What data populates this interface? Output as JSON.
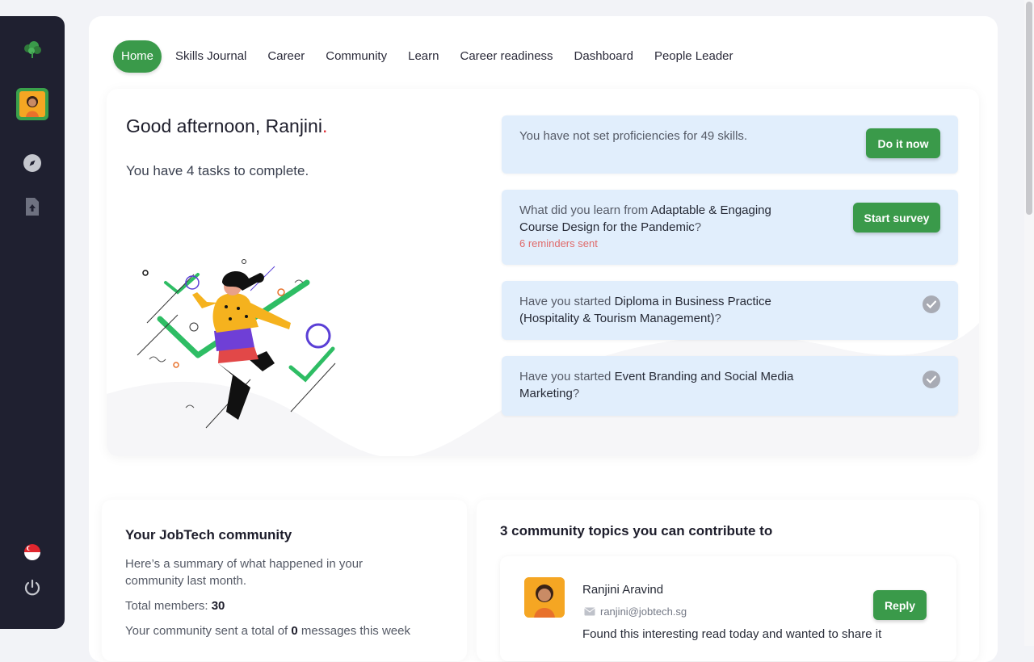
{
  "nav": {
    "items": [
      {
        "label": "Home",
        "active": true
      },
      {
        "label": "Skills Journal"
      },
      {
        "label": "Career"
      },
      {
        "label": "Community"
      },
      {
        "label": "Learn"
      },
      {
        "label": "Career readiness"
      },
      {
        "label": "Dashboard"
      },
      {
        "label": "People Leader"
      }
    ]
  },
  "hero": {
    "greeting": "Good afternoon, Ranjini",
    "greeting_punct": ".",
    "tasks_text": "You have 4 tasks to complete."
  },
  "tasks": [
    {
      "text": "You have not set proficiencies for 49 skills.",
      "button": "Do it now"
    },
    {
      "prefix": "What did you learn from ",
      "highlight": "Adaptable & Engaging Course Design for the Pandemic",
      "suffix": "?",
      "reminders": "6 reminders sent",
      "button": "Start survey"
    },
    {
      "prefix": "Have you started ",
      "highlight": "Diploma in Business Practice (Hospitality & Tourism Management)",
      "suffix": "?",
      "status": "check-icon"
    },
    {
      "prefix": "Have you started ",
      "highlight": "Event Branding and Social Media Marketing",
      "suffix": "?",
      "status": "check-icon"
    }
  ],
  "community": {
    "title": "Your JobTech community",
    "summary": "Here’s a summary of what happened in your community last month.",
    "members_label": "Total members: ",
    "members_value": "30",
    "messages_prefix": "Your community sent a total of ",
    "messages_value": "0",
    "messages_suffix": " messages this week"
  },
  "topics": {
    "title": "3 community topics you can contribute to",
    "items": [
      {
        "name": "Ranjini Aravind",
        "email": "ranjini@jobtech.sg",
        "text": "Found this interesting read today and wanted to share it",
        "button": "Reply"
      }
    ]
  },
  "colors": {
    "accent": "#3a9a4a",
    "sidebar": "#1f2030",
    "task_bg": "#e1eefc",
    "reminder": "#e06a6a"
  },
  "sidebar": {
    "icons": [
      "tree-logo-icon",
      "avatar",
      "compass-icon",
      "upload-icon",
      "singapore-flag-icon",
      "power-icon"
    ]
  }
}
